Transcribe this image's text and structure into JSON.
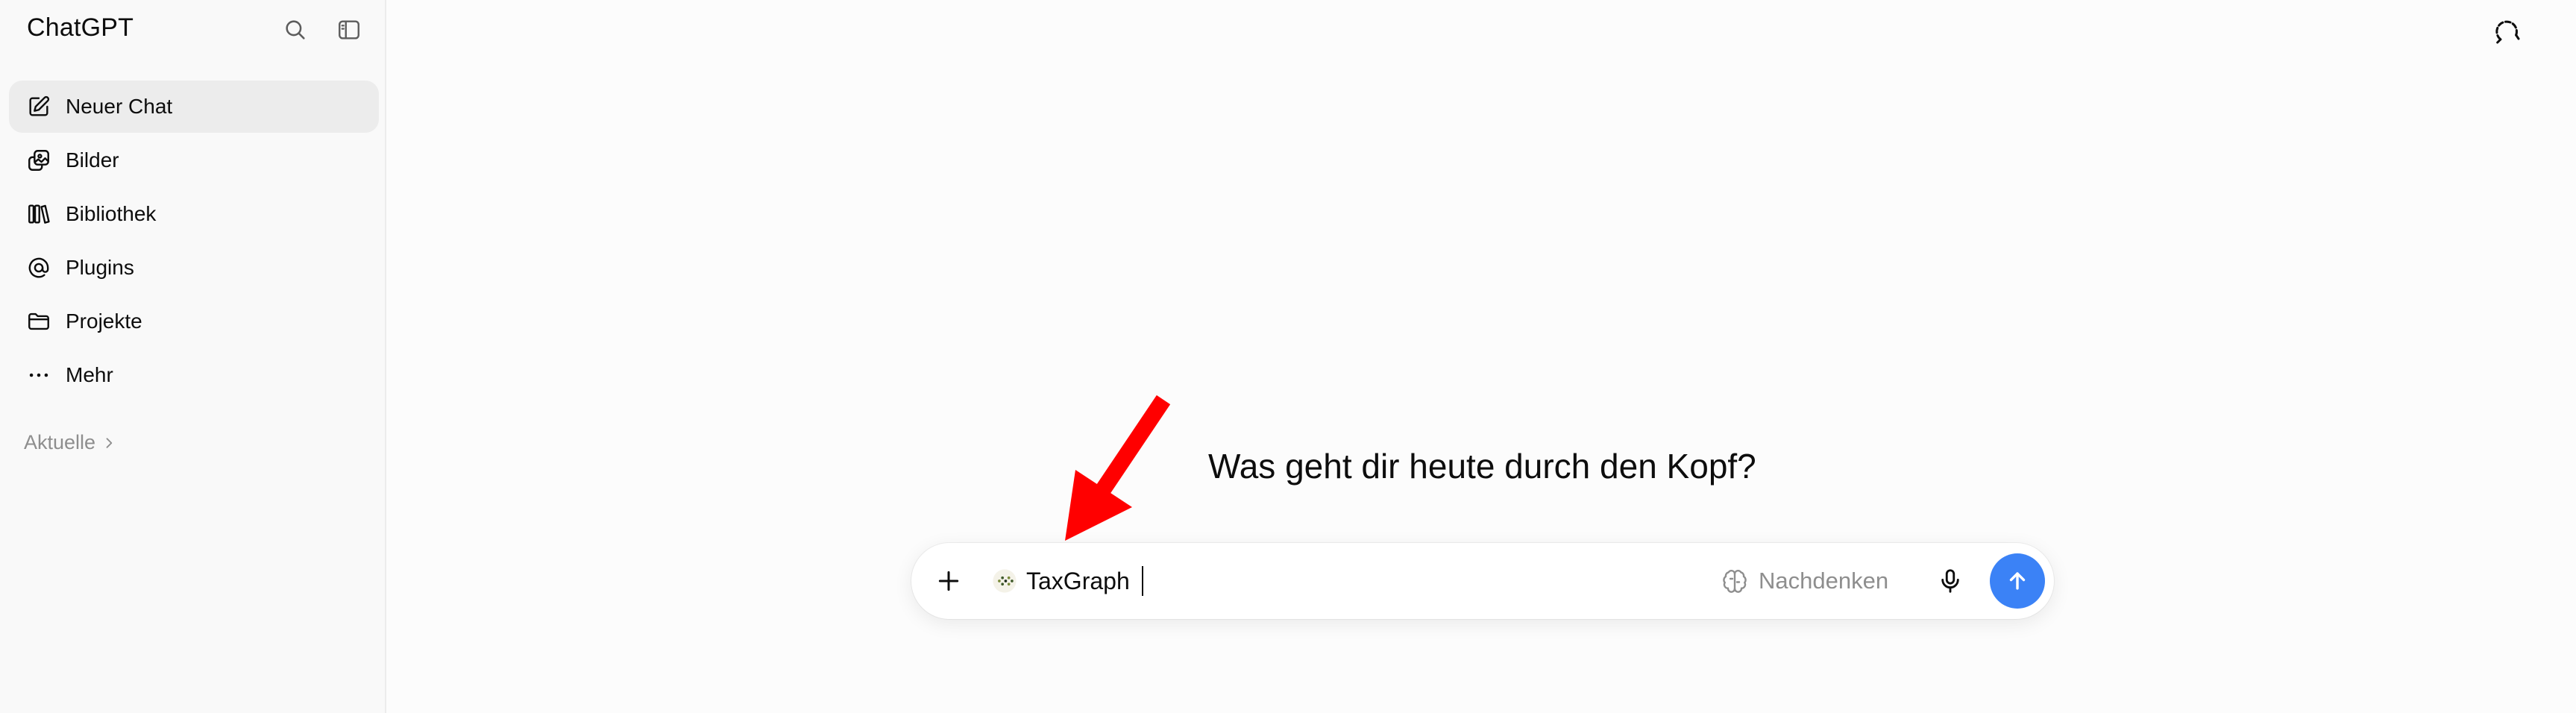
{
  "sidebar": {
    "brand": "ChatGPT",
    "items": [
      {
        "label": "Neuer Chat",
        "icon": "edit-icon"
      },
      {
        "label": "Bilder",
        "icon": "images-icon"
      },
      {
        "label": "Bibliothek",
        "icon": "library-icon"
      },
      {
        "label": "Plugins",
        "icon": "at-icon"
      },
      {
        "label": "Projekte",
        "icon": "folder-icon"
      },
      {
        "label": "Mehr",
        "icon": "more-dots-icon"
      }
    ],
    "section_label": "Aktuelle"
  },
  "main": {
    "headline": "Was geht dir heute durch den Kopf?"
  },
  "composer": {
    "plugin_label": "TaxGraph",
    "think_label": "Nachdenken",
    "send_color": "#3b82f6"
  },
  "colors": {
    "accent": "#3b82f6",
    "annotation": "#ff0000",
    "active_item_bg": "#ececec"
  }
}
